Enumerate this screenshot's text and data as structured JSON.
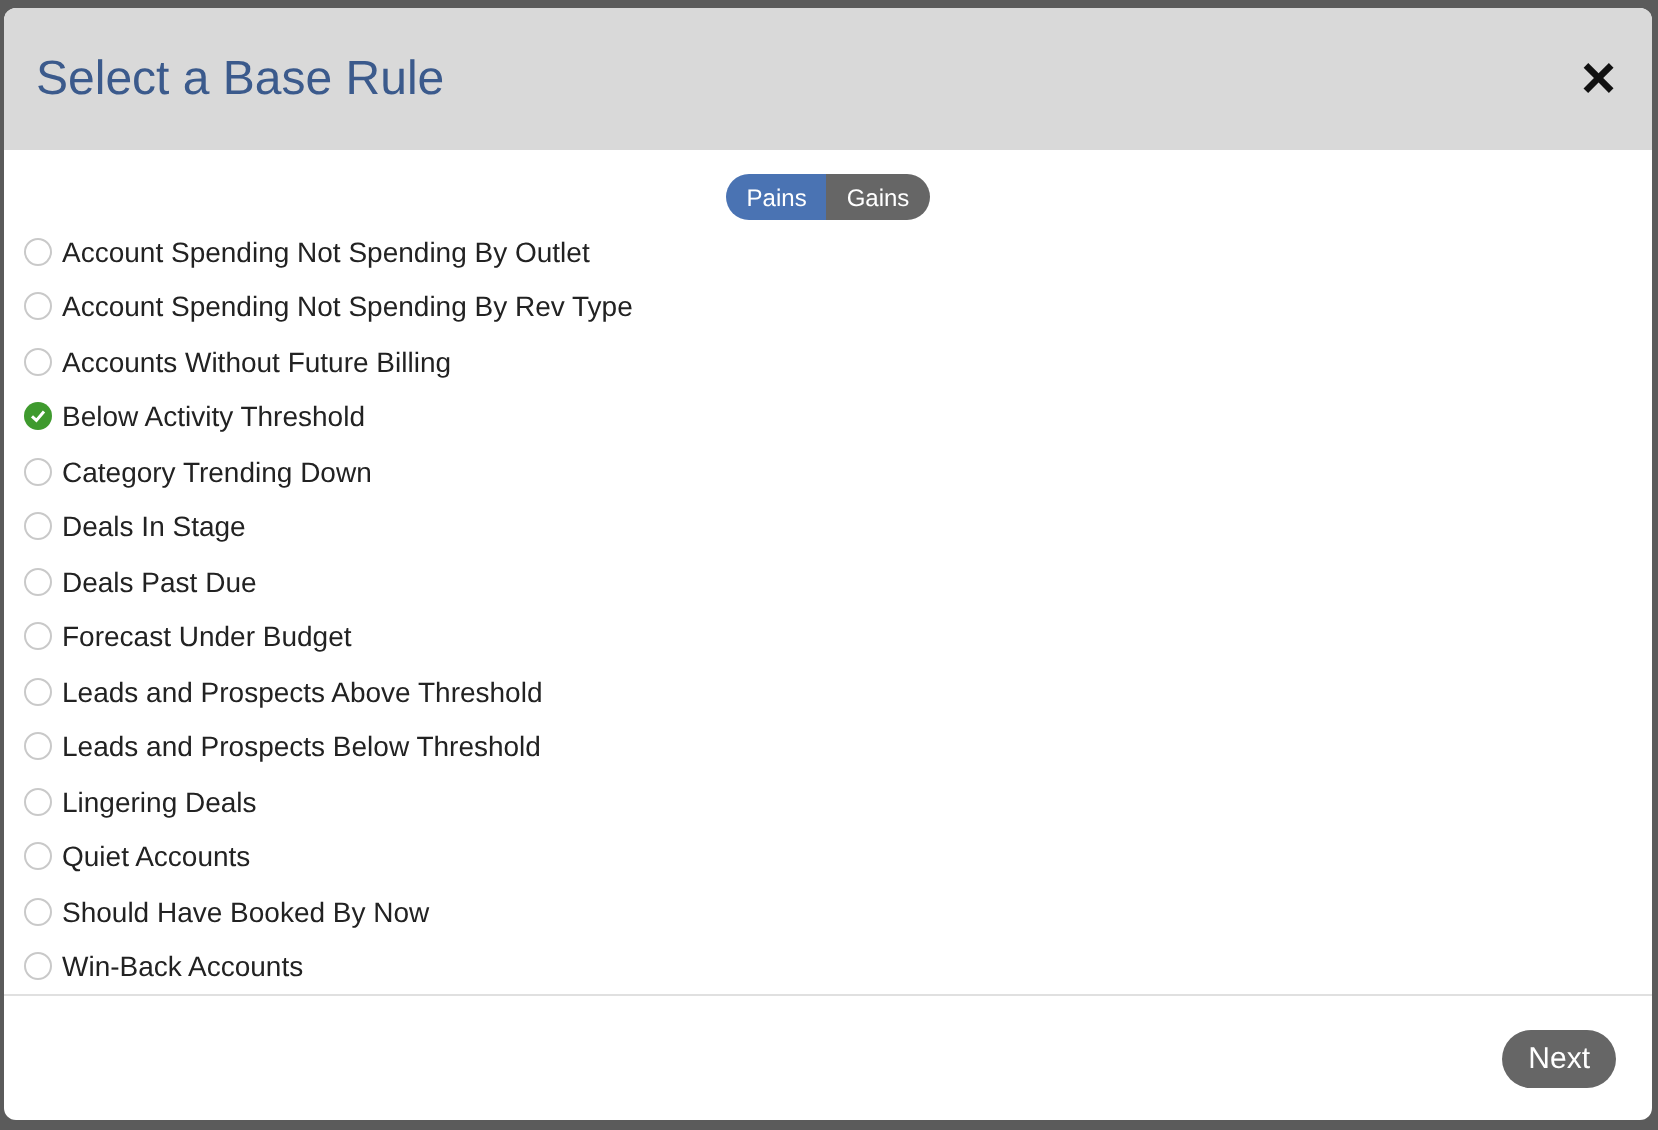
{
  "dialog": {
    "title": "Select a Base Rule",
    "close": "×"
  },
  "toggle": [
    {
      "label": "Pains",
      "selected": true
    },
    {
      "label": "Gains",
      "selected": false
    }
  ],
  "rules": [
    {
      "label": "Account Spending Not Spending By Outlet",
      "selected": false
    },
    {
      "label": "Account Spending Not Spending By Rev Type",
      "selected": false
    },
    {
      "label": "Accounts Without Future Billing",
      "selected": false
    },
    {
      "label": "Below Activity Threshold",
      "selected": true
    },
    {
      "label": "Category Trending Down",
      "selected": false
    },
    {
      "label": "Deals In Stage",
      "selected": false
    },
    {
      "label": "Deals Past Due",
      "selected": false
    },
    {
      "label": "Forecast Under Budget",
      "selected": false
    },
    {
      "label": "Leads and Prospects Above Threshold",
      "selected": false
    },
    {
      "label": "Leads and Prospects Below Threshold",
      "selected": false
    },
    {
      "label": "Lingering Deals",
      "selected": false
    },
    {
      "label": "Quiet Accounts",
      "selected": false
    },
    {
      "label": "Should Have Booked By Now",
      "selected": false
    },
    {
      "label": "Win-Back Accounts",
      "selected": false
    }
  ],
  "footer": {
    "next": "Next"
  }
}
